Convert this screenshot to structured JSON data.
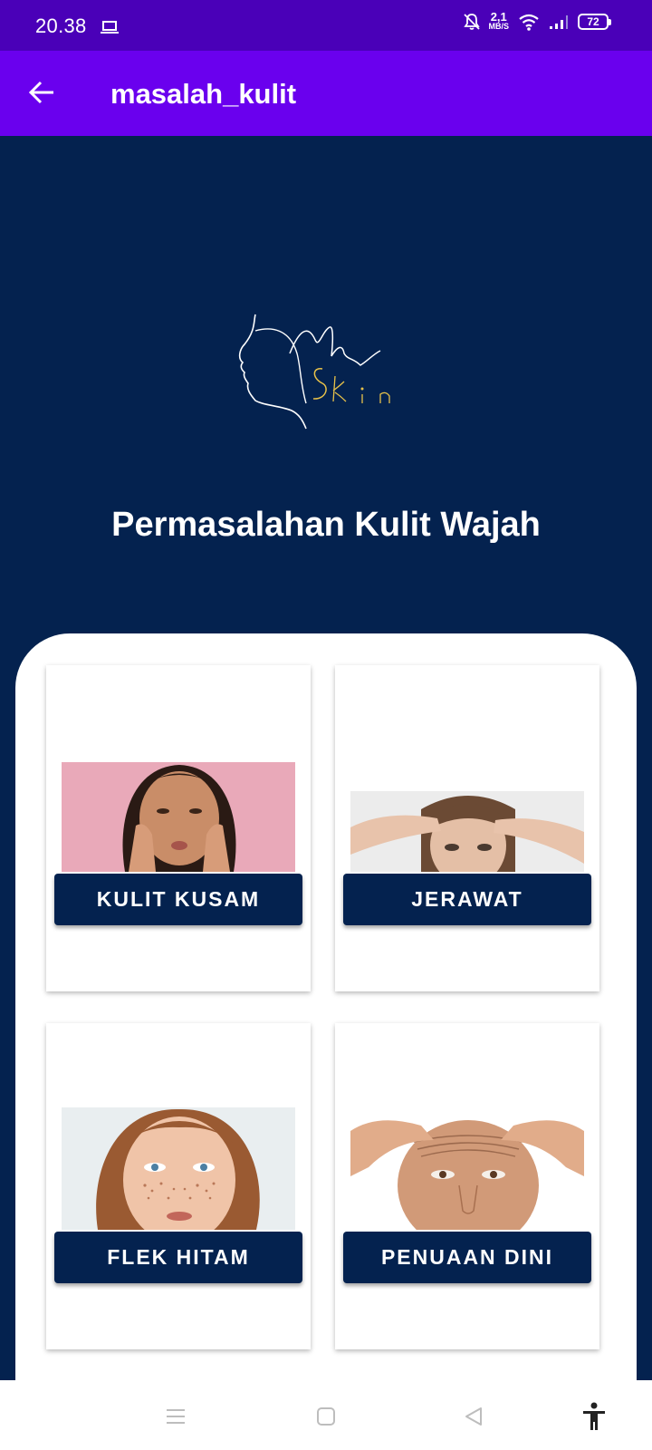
{
  "status_bar": {
    "time": "20.38",
    "net_speed_value": "2,1",
    "net_speed_unit": "MB/S",
    "battery": "72"
  },
  "app_bar": {
    "title": "masalah_kulit",
    "back_icon": "arrow-left-icon"
  },
  "logo": {
    "line1": "My",
    "line2": "Skin"
  },
  "heading": "Permasalahan Kulit Wajah",
  "cards": [
    {
      "label": "KULIT KUSAM",
      "image": "dull-skin-photo"
    },
    {
      "label": "JERAWAT",
      "image": "acne-photo"
    },
    {
      "label": "FLEK HITAM",
      "image": "dark-spots-photo"
    },
    {
      "label": "PENUAAN DINI",
      "image": "premature-aging-photo"
    }
  ],
  "nav_bar": {
    "items": [
      "menu-icon",
      "home-icon",
      "back-icon",
      "accessibility-icon"
    ]
  },
  "colors": {
    "status_bar": "#4a00b8",
    "app_bar": "#6a00ee",
    "background": "#04224f",
    "button": "#04224f",
    "logo_accent": "#e8c24a"
  }
}
